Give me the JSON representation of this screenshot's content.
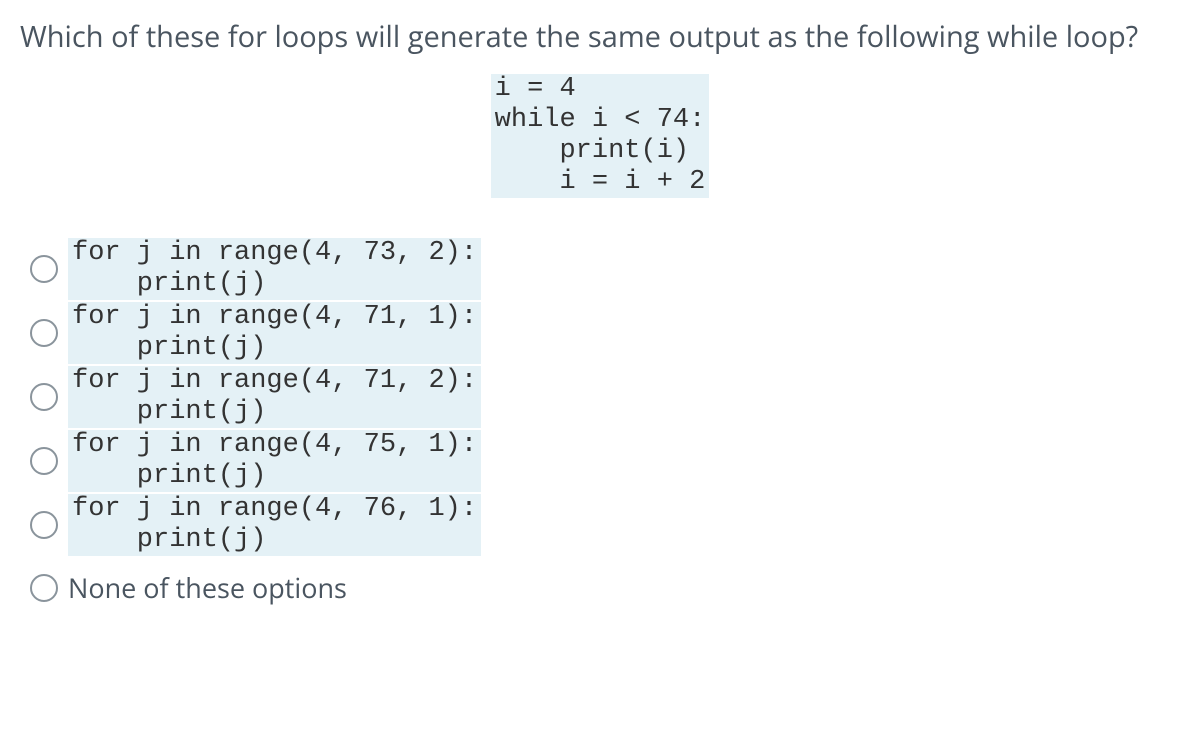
{
  "question": "Which of these for loops will generate the same output as the following while loop?",
  "reference_code": "i = 4\nwhile i < 74:\n    print(i)\n    i = i + 2",
  "options": [
    {
      "type": "code",
      "content": "for j in range(4, 73, 2):\n    print(j)"
    },
    {
      "type": "code",
      "content": "for j in range(4, 71, 1):\n    print(j)"
    },
    {
      "type": "code",
      "content": "for j in range(4, 71, 2):\n    print(j)"
    },
    {
      "type": "code",
      "content": "for j in range(4, 75, 1):\n    print(j)"
    },
    {
      "type": "code",
      "content": "for j in range(4, 76, 1):\n    print(j)"
    },
    {
      "type": "text",
      "content": "None of these options"
    }
  ]
}
